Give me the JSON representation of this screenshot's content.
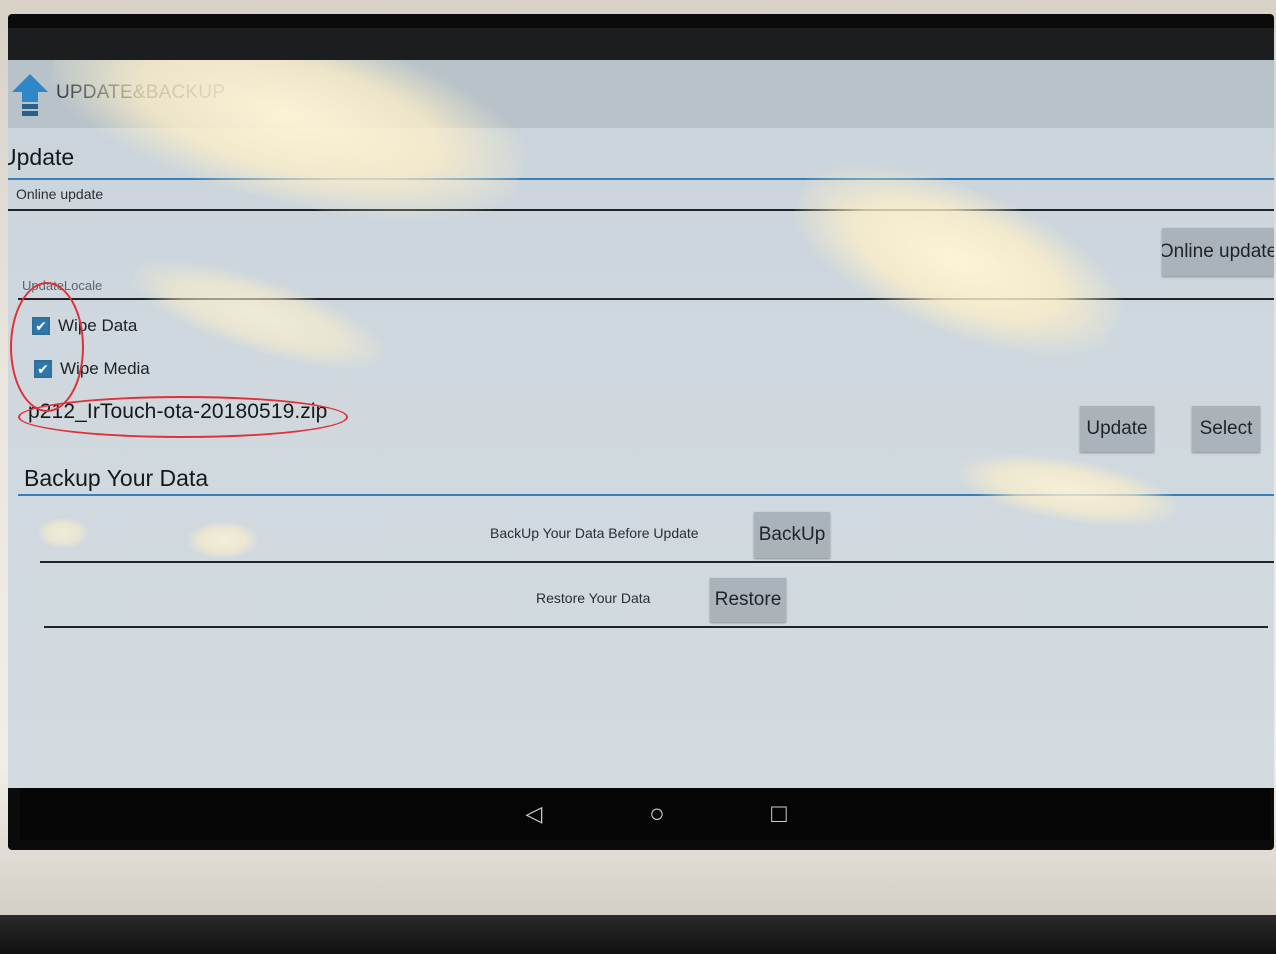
{
  "app": {
    "title": "UPDATE&BACKUP"
  },
  "update": {
    "section_title": "Update",
    "online_label": "Online update",
    "online_button": "Online update",
    "local_label": "UpdateLocale",
    "wipe_data_label": "Wipe Data",
    "wipe_data_checked": true,
    "wipe_media_label": "Wipe Media",
    "wipe_media_checked": true,
    "filename": "p212_IrTouch-ota-20180519.zip",
    "update_button": "Update",
    "select_button": "Select"
  },
  "backup": {
    "section_title": "Backup Your Data",
    "backup_label": "BackUp Your Data Before Update",
    "backup_button": "BackUp",
    "restore_label": "Restore Your Data",
    "restore_button": "Restore"
  },
  "navbar": {
    "back_glyph": "◁",
    "home_glyph": "○",
    "recents_glyph": "□"
  },
  "colors": {
    "screen_bg": "#cfd8de",
    "action_bar_bg": "#b7c2c9",
    "accent_blue": "#3a7fb5",
    "button_bg": "#aab3ba",
    "annotation_red": "#e0303a"
  }
}
